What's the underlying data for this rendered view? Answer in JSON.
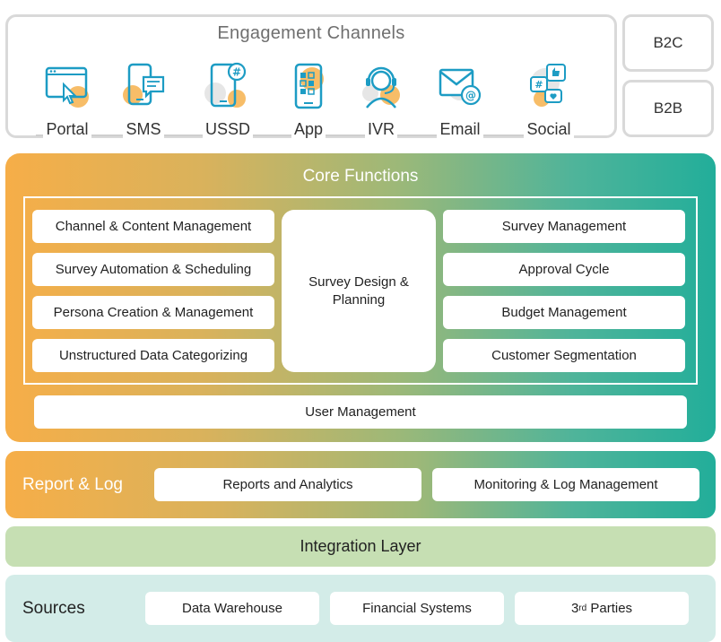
{
  "engagement": {
    "title": "Engagement Channels",
    "channels": [
      {
        "label": "Portal",
        "icon": "browser-cursor-icon"
      },
      {
        "label": "SMS",
        "icon": "phone-message-icon"
      },
      {
        "label": "USSD",
        "icon": "phone-hash-icon"
      },
      {
        "label": "App",
        "icon": "phone-app-icon"
      },
      {
        "label": "IVR",
        "icon": "headset-agent-icon"
      },
      {
        "label": "Email",
        "icon": "envelope-at-icon"
      },
      {
        "label": "Social",
        "icon": "social-bubbles-icon"
      }
    ],
    "segments": [
      "B2C",
      "B2B"
    ]
  },
  "core": {
    "title": "Core Functions",
    "left": [
      "Channel & Content Management",
      "Survey Automation & Scheduling",
      "Persona Creation & Management",
      "Unstructured Data Categorizing"
    ],
    "center": "Survey Design & Planning",
    "right": [
      "Survey Management",
      "Approval Cycle",
      "Budget Management",
      "Customer Segmentation"
    ],
    "bottom": "User Management"
  },
  "report": {
    "title": "Report & Log",
    "items": [
      "Reports and Analytics",
      "Monitoring & Log Management"
    ]
  },
  "integration": {
    "title": "Integration Layer"
  },
  "sources": {
    "title": "Sources",
    "items": [
      "Data Warehouse",
      "Financial Systems"
    ],
    "third_parties": {
      "prefix": "3",
      "superscript": "rd",
      "suffix": " Parties"
    }
  },
  "colors": {
    "orange": "#f6ae48",
    "teal": "#22ae9a",
    "icon_blue": "#1d9cc4",
    "icon_orange": "#f6b24d",
    "integration_green": "#c6dfb3",
    "sources_bg": "#d3ece8"
  }
}
